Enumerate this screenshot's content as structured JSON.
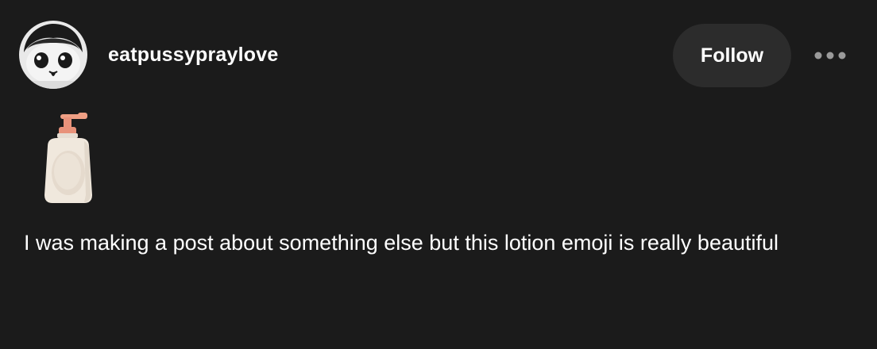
{
  "post": {
    "username": "eatpussypraylove",
    "follow_label": "Follow",
    "body": "I was making a post about something else but this lotion emoji is really beautiful"
  },
  "icons": {
    "avatar": "avatar-face",
    "more": "more-dots-icon",
    "emoji": "lotion-bottle-emoji"
  },
  "colors": {
    "background": "#1b1b1b",
    "button": "#2c2c2c",
    "text": "#ffffff",
    "dots": "#9a9a9a"
  }
}
